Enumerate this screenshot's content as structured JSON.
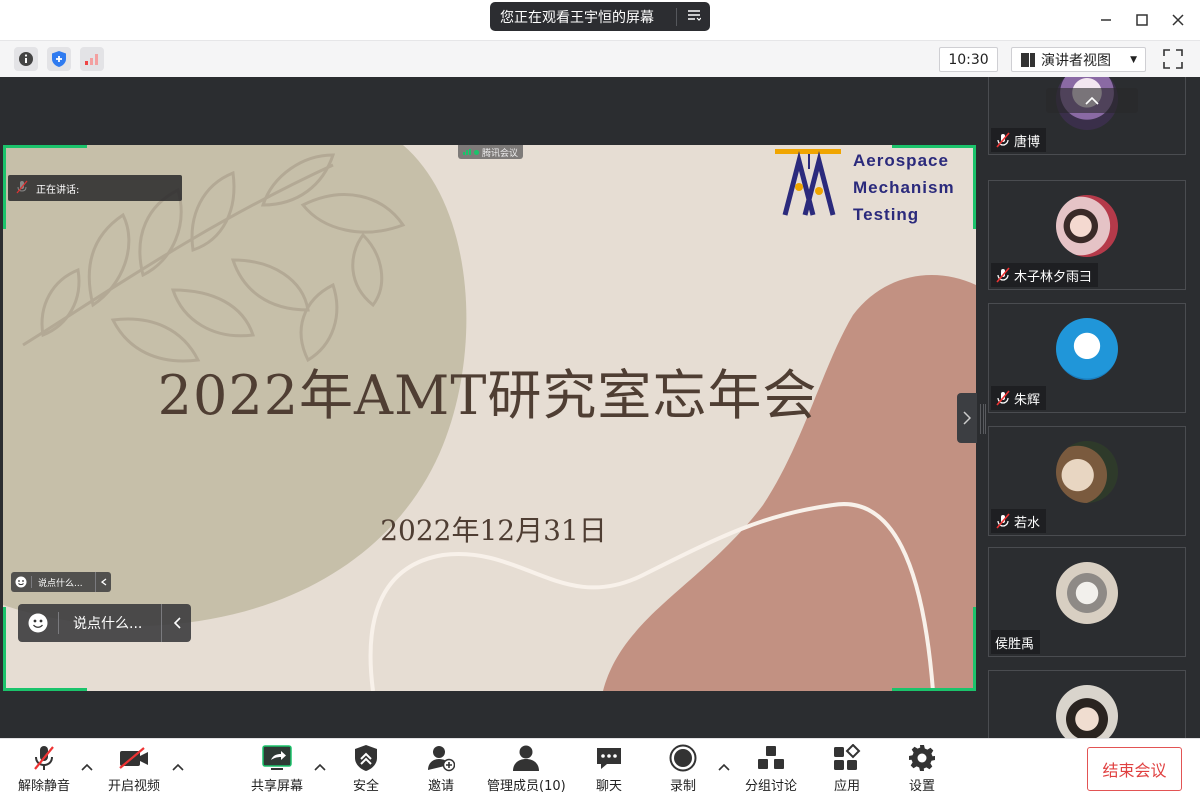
{
  "titlebar": {
    "banner": "您正在观看王宇恒的屏幕"
  },
  "infobar": {
    "time": "10:30",
    "view_mode": "演讲者视图"
  },
  "slide": {
    "title": "2022年AMT研究室忘年会",
    "date": "2022年12月31日",
    "logo": [
      "Aerospace",
      "Mechanism",
      "Testing"
    ],
    "meeting_tag": "腾讯会议",
    "speaking_label": "正在讲话:",
    "chat_placeholder_small": "说点什么...",
    "chat_placeholder": "说点什么..."
  },
  "participants": [
    {
      "name": "唐博",
      "muted": true
    },
    {
      "name": "木子林夕雨彐",
      "muted": true
    },
    {
      "name": "朱辉",
      "muted": true
    },
    {
      "name": "若水",
      "muted": true
    },
    {
      "name": "侯胜禹",
      "muted": false
    },
    {
      "name": "",
      "muted": false
    }
  ],
  "toolbar": {
    "unmute": "解除静音",
    "video": "开启视频",
    "share": "共享屏幕",
    "security": "安全",
    "invite": "邀请",
    "members": "管理成员(10)",
    "chat": "聊天",
    "record": "录制",
    "breakout": "分组讨论",
    "apps": "应用",
    "settings": "设置",
    "end": "结束会议"
  },
  "colors": {
    "accent_green": "#1bc36b",
    "end_red": "#e04040",
    "slide_text": "#4f3e33",
    "logo_blue": "#2b2a7c"
  }
}
